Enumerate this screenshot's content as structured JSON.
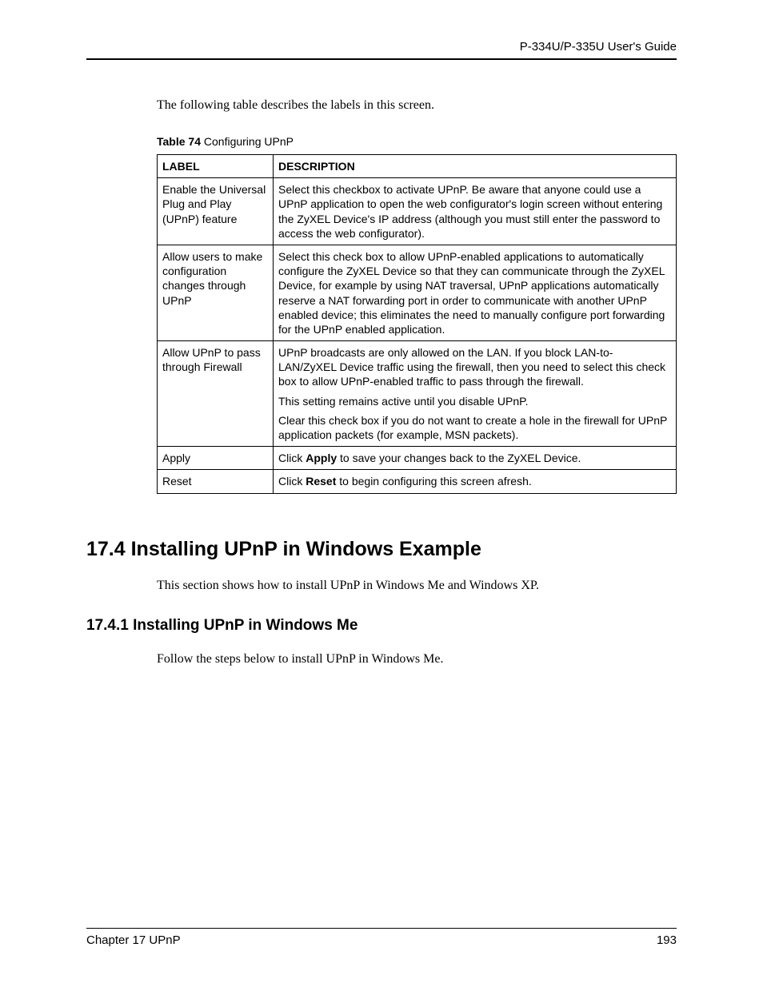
{
  "header": "P-334U/P-335U User's Guide",
  "intro": "The following table describes the labels in this screen.",
  "table_caption_bold": "Table 74",
  "table_caption_rest": "   Configuring UPnP",
  "th_label": "LABEL",
  "th_desc": "DESCRIPTION",
  "rows": [
    {
      "label": "Enable the Universal Plug and Play (UPnP) feature",
      "desc": [
        "Select this checkbox to activate UPnP. Be aware that anyone could use a UPnP application to open the web configurator's login screen without entering the ZyXEL Device's IP address (although you must still enter the password to access the web configurator)."
      ]
    },
    {
      "label": "Allow users to make configuration changes through UPnP",
      "desc": [
        "Select this check box to allow UPnP-enabled applications to automatically configure the ZyXEL Device so that they can communicate through the ZyXEL Device, for example by using NAT traversal, UPnP applications automatically reserve a NAT forwarding port in order to communicate with another UPnP enabled device; this eliminates the need to manually configure port forwarding for the UPnP enabled application."
      ]
    },
    {
      "label": "Allow UPnP to pass through Firewall",
      "desc": [
        "UPnP broadcasts are only allowed on the LAN. If you block LAN-to-LAN/ZyXEL Device traffic using the firewall, then you need to select this check box to allow UPnP-enabled traffic to pass through the firewall.",
        "This setting remains active until you disable UPnP.",
        "Clear this check box if you do not want to create a hole in the firewall for UPnP application packets (for example, MSN packets)."
      ]
    },
    {
      "label": "Apply",
      "desc_pre": "Click ",
      "desc_bold": "Apply",
      "desc_post": " to save your changes back to the ZyXEL Device."
    },
    {
      "label": "Reset",
      "desc_pre": "Click ",
      "desc_bold": "Reset",
      "desc_post": " to begin configuring this screen afresh."
    }
  ],
  "section_heading": "17.4  Installing UPnP in Windows Example",
  "section_body": "This section shows how to install UPnP in Windows Me and Windows XP.",
  "subsection_heading": "17.4.1  Installing UPnP in Windows Me",
  "subsection_body": "Follow the steps below to install UPnP in Windows Me.",
  "footer_left": "Chapter 17 UPnP",
  "footer_right": "193"
}
